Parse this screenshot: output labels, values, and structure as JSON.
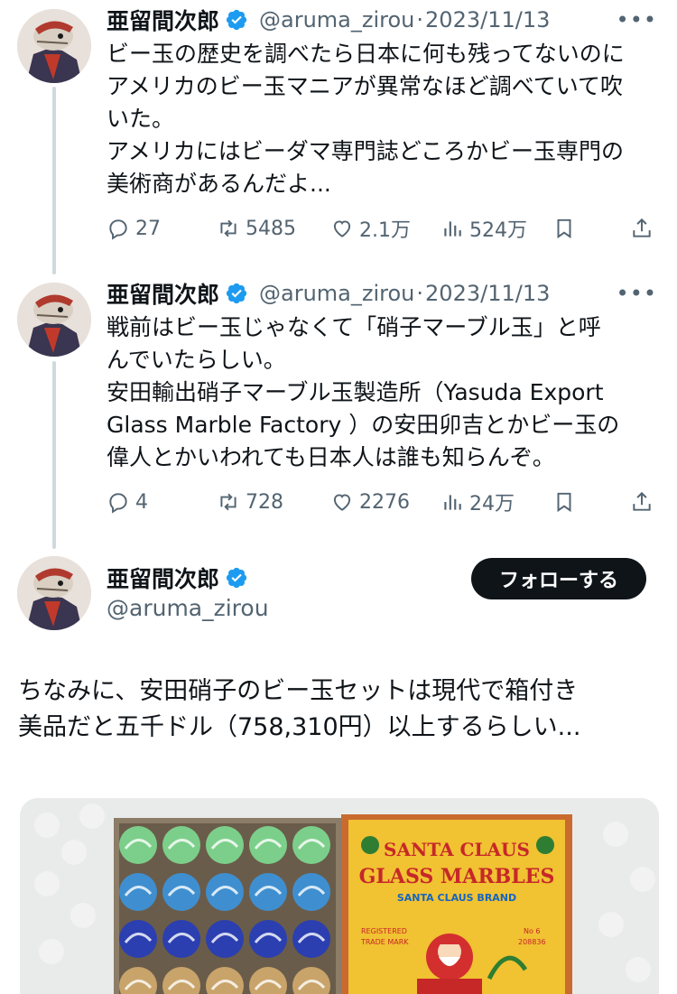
{
  "tweets": [
    {
      "name": "亜留間次郎",
      "handle": "@aruma_zirou",
      "separator": "·",
      "date": "2023/11/13",
      "more": "•••",
      "text": "ビー玉の歴史を調べたら日本に何も残ってないのに\nアメリカのビー玉マニアが異常なほど調べていて吹\nいた。\nアメリカにはビーダマ専門誌どころかビー玉専門の\n美術商があるんだよ...",
      "stats": {
        "replies": "27",
        "reposts": "5485",
        "likes": "2.1万",
        "views": "524万"
      }
    },
    {
      "name": "亜留間次郎",
      "handle": "@aruma_zirou",
      "separator": "·",
      "date": "2023/11/13",
      "more": "•••",
      "text": "戦前はビー玉じゃなくて「硝子マーブル玉」と呼\nんでいたらしい。\n安田輸出硝子マーブル玉製造所（Yasuda Export\nGlass Marble Factory ）の安田卯吉とかビー玉の\n偉人とかいわれても日本人は誰も知らんぞ。",
      "stats": {
        "replies": "4",
        "reposts": "728",
        "likes": "2276",
        "views": "24万"
      }
    }
  ],
  "main": {
    "name": "亜留間次郎",
    "handle": "@aruma_zirou",
    "follow_label": "フォローする",
    "text": "ちなみに、安田硝子のビー玉セットは現代で箱付き\n美品だと五千ドル（758,310円）以上するらしい...",
    "image": {
      "box_line1": "SANTA CLAUS",
      "box_line2": "GLASS MARBLES",
      "box_line3": "SANTA CLAUS BRAND",
      "box_reg": "REGISTERED",
      "box_trademark": "TRADE MARK",
      "box_no": "No 6",
      "box_serial": "208836"
    }
  },
  "colors": {
    "text_primary": "#0f1419",
    "text_secondary": "#536471",
    "verified": "#1d9bf0",
    "thread_line": "#cfd9de",
    "follow_bg": "#0f1419"
  },
  "icons": [
    "reply-icon",
    "repost-icon",
    "like-icon",
    "views-icon",
    "bookmark-icon",
    "share-icon",
    "verified-icon",
    "more-icon"
  ]
}
